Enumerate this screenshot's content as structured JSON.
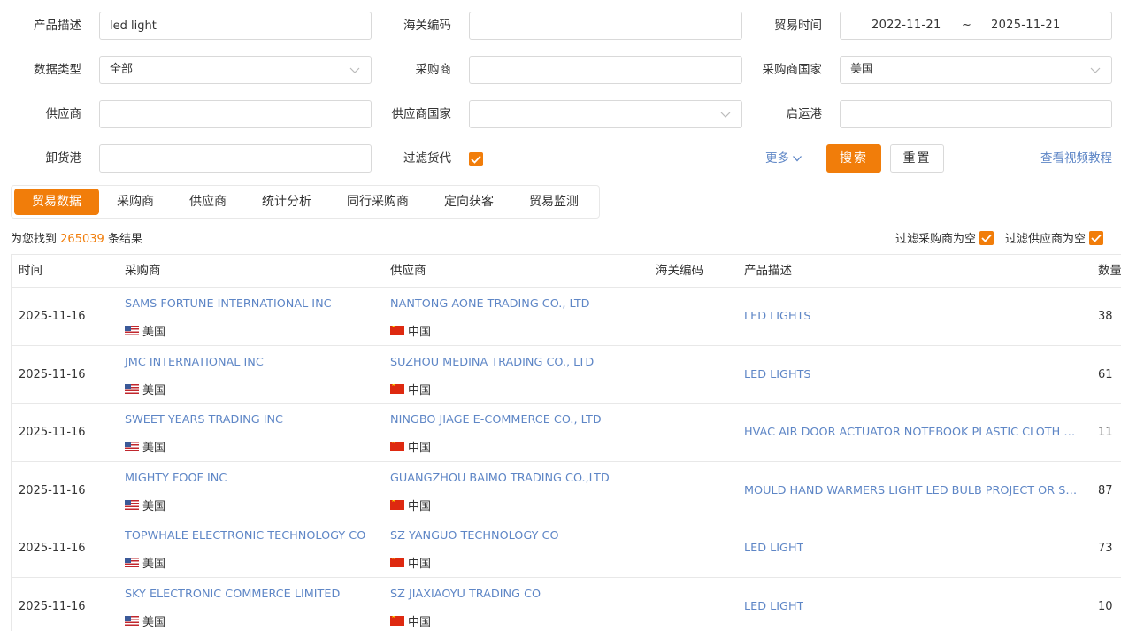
{
  "search_form": {
    "product_desc": {
      "label": "产品描述",
      "value": "led light"
    },
    "hs_code": {
      "label": "海关编码",
      "value": ""
    },
    "trade_time": {
      "label": "贸易时间",
      "start": "2022-11-21",
      "separator": "~",
      "end": "2025-11-21"
    },
    "data_type": {
      "label": "数据类型",
      "value": "全部"
    },
    "buyer": {
      "label": "采购商",
      "value": ""
    },
    "buyer_country": {
      "label": "采购商国家",
      "value": "美国"
    },
    "supplier": {
      "label": "供应商",
      "value": ""
    },
    "supplier_country": {
      "label": "供应商国家",
      "value": ""
    },
    "origin_port": {
      "label": "启运港",
      "value": ""
    },
    "dest_port": {
      "label": "卸货港",
      "value": ""
    },
    "filter_forwarder": {
      "label": "过滤货代",
      "checked": true
    },
    "more_label": "更多",
    "search_label": "搜索",
    "reset_label": "重置",
    "video_tutorial_label": "查看视频教程"
  },
  "tabs": [
    "贸易数据",
    "采购商",
    "供应商",
    "统计分析",
    "同行采购商",
    "定向获客",
    "贸易监测"
  ],
  "active_tab": 0,
  "results": {
    "prefix": "为您找到",
    "count": "265039",
    "suffix": "条结果",
    "filter_buyer_empty": "过滤采购商为空",
    "filter_supplier_empty": "过滤供应商为空"
  },
  "table": {
    "columns": [
      "时间",
      "采购商",
      "供应商",
      "海关编码",
      "产品描述",
      "数量"
    ],
    "rows": [
      {
        "date": "2025-11-16",
        "buyer": "SAMS FORTUNE INTERNATIONAL INC",
        "buyer_country": "美国",
        "supplier": "NANTONG AONE TRADING CO., LTD",
        "supplier_country": "中国",
        "hs_code": "",
        "product": "LED LIGHTS",
        "qty": "38"
      },
      {
        "date": "2025-11-16",
        "buyer": "JMC INTERNATIONAL INC",
        "buyer_country": "美国",
        "supplier": "SUZHOU MEDINA TRADING CO., LTD",
        "supplier_country": "中国",
        "hs_code": "",
        "product": "LED LIGHTS",
        "qty": "61"
      },
      {
        "date": "2025-11-16",
        "buyer": "SWEET YEARS TRADING INC",
        "buyer_country": "美国",
        "supplier": "NINGBO JIAGE E-COMMERCE CO., LTD",
        "supplier_country": "中国",
        "hs_code": "",
        "product": "HVAC AIR DOOR ACTUATOR NOTEBOOK PLASTIC CLOTH SET LE...",
        "qty": "11"
      },
      {
        "date": "2025-11-16",
        "buyer": "MIGHTY FOOF INC",
        "buyer_country": "美国",
        "supplier": "GUANGZHOU BAIMO TRADING CO.,LTD",
        "supplier_country": "中国",
        "hs_code": "",
        "product": "MOULD HAND WARMERS LIGHT LED BULB PROJECT OR SPEAKER",
        "qty": "87"
      },
      {
        "date": "2025-11-16",
        "buyer": "TOPWHALE ELECTRONIC TECHNOLOGY CO",
        "buyer_country": "美国",
        "supplier": "SZ YANGUO TECHNOLOGY CO",
        "supplier_country": "中国",
        "hs_code": "",
        "product": "LED LIGHT",
        "qty": "73"
      },
      {
        "date": "2025-11-16",
        "buyer": "SKY ELECTRONIC COMMERCE LIMITED",
        "buyer_country": "美国",
        "supplier": "SZ JIAXIAOYU TRADING CO",
        "supplier_country": "中国",
        "hs_code": "",
        "product": "LED LIGHT",
        "qty": "10"
      }
    ]
  },
  "colors": {
    "accent": "#f17d0a",
    "link": "#5e86c6",
    "border": "#d9d9d9"
  }
}
